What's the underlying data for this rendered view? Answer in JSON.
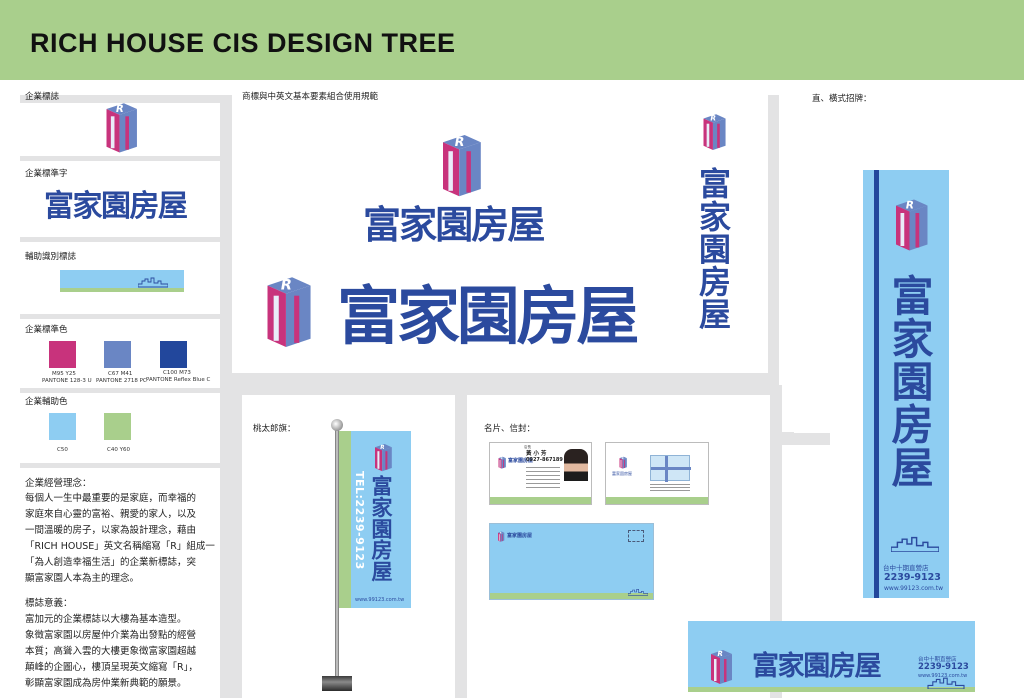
{
  "header": {
    "title": "RICH HOUSE CIS DESIGN TREE"
  },
  "brand_name": "富家園房屋",
  "sections": {
    "logo": "企業標誌",
    "wordmark": "企業標準字",
    "aux_mark": "輔助識別標誌",
    "std_colors": "企業標準色",
    "aux_colors": "企業輔助色",
    "combo": "商標與中英文基本要素組合使用規範",
    "signboard": "直、橫式招牌：",
    "flag": "桃太郎旗：",
    "cards": "名片、信封："
  },
  "colors": {
    "standard": [
      {
        "hex": "#c8337c",
        "code": "M95 Y25",
        "pantone": "PANTONE 128-3 U"
      },
      {
        "hex": "#6a86c4",
        "code": "C67 M41",
        "pantone": "PANTONE 2718 PC"
      },
      {
        "hex": "#22479c",
        "code": "C100 M73",
        "pantone": "PANTONE Reflex Blue C"
      }
    ],
    "auxiliary": [
      {
        "hex": "#8ecdf2",
        "code": "C50"
      },
      {
        "hex": "#a9cf8c",
        "code": "C40 Y60"
      }
    ]
  },
  "philosophy": {
    "title": "企業經營理念：",
    "lines": [
      "每個人一生中最重要的是家庭，而幸福的",
      "家庭來自心靈的富裕、親愛的家人，以及",
      "一間溫暖的房子，以家為設計理念，藉由",
      "「RICH HOUSE」英文名稱縮寫「R」組成一",
      "「為人創造幸福生活」的企業新標誌，突",
      "顯富家園人本為主的理念。"
    ]
  },
  "meaning": {
    "title": "標誌意義：",
    "lines": [
      "富加元的企業標誌以大樓為基本造型。",
      "象徵富家園以房屋仲介業為出發點的經營",
      "本質；高聳入雲的大樓更象徵富家園超越",
      "顛峰的企圖心，樓頂呈現英文縮寫「R」，",
      "彰顯富家園成為房仲業新典範的願景。"
    ]
  },
  "flag": {
    "tel": "TEL:2239-9123",
    "url": "www.99123.com.tw"
  },
  "signboard": {
    "branch": "台中十期直營店",
    "phone": "2239-9123",
    "url": "www.99123.com.tw"
  },
  "business_card": {
    "title": "店長",
    "name": "黃 小 芳",
    "mobile": "0927-867189",
    "company": "富家園房屋",
    "back_title": "富家園房屋",
    "back_phone": "2239-9123",
    "back_url": "www.99123.com.tw"
  }
}
